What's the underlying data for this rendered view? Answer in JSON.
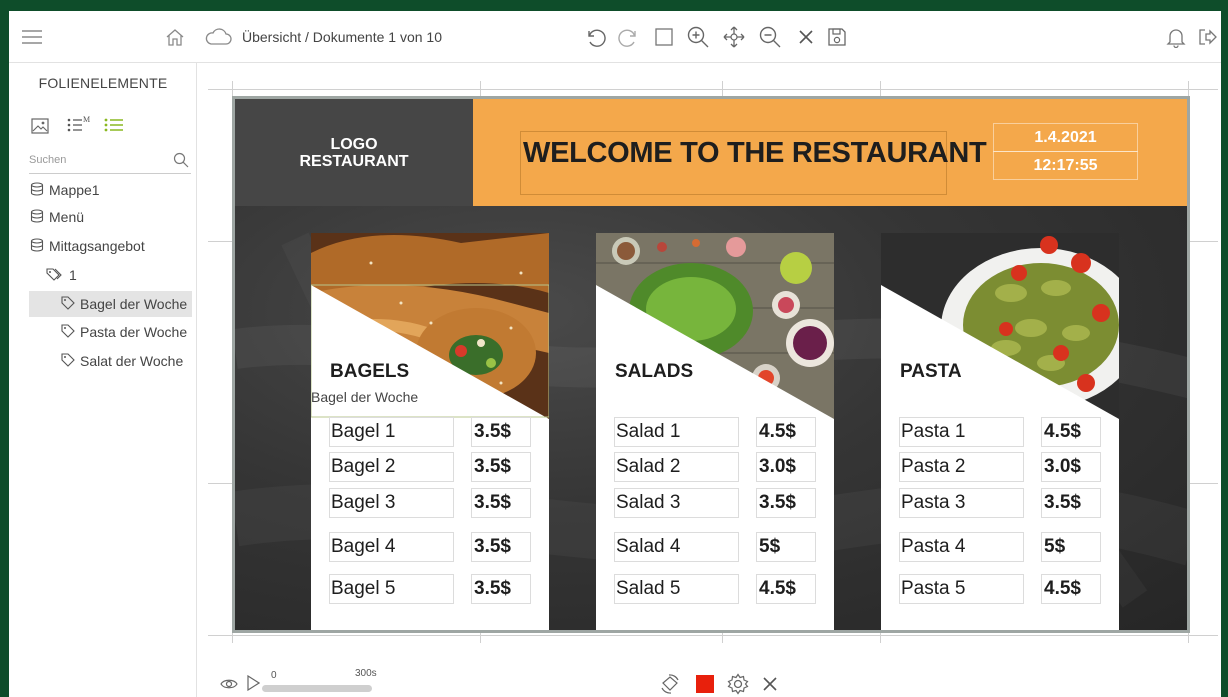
{
  "toolbar": {
    "breadcrumb": "Übersicht / Dokumente  1 von 10",
    "icons": [
      "menu-icon",
      "home-icon",
      "cloud-icon",
      "undo-icon",
      "redo-icon",
      "square-select-icon",
      "zoom-in-icon",
      "move-icon",
      "zoom-out-icon",
      "close-icon",
      "save-icon",
      "bell-icon",
      "logout-icon"
    ]
  },
  "sidebar": {
    "title": "FOLIENELEMENTE",
    "search_placeholder": "Suchen",
    "tree": [
      {
        "label": "Mappe1",
        "type": "database"
      },
      {
        "label": "Menü",
        "type": "database"
      },
      {
        "label": "Mittagsangebot",
        "type": "database"
      },
      {
        "label": "1",
        "type": "tags"
      },
      {
        "label": "Bagel der Woche",
        "type": "tag",
        "selected": true
      },
      {
        "label": "Pasta der Woche",
        "type": "tag"
      },
      {
        "label": "Salat der Woche",
        "type": "tag"
      }
    ]
  },
  "slide": {
    "logo_line1": "LOGO",
    "logo_line2": "RESTAURANT",
    "banner_title": "WELCOME TO THE RESTAURANT",
    "date": "1.4.2021",
    "time": "12:17:55",
    "colors": {
      "banner": "#f4a84b",
      "logo_bg": "#464646",
      "board": "#353535"
    },
    "cards": [
      {
        "heading": "BAGELS",
        "subtitle": "Bagel der Woche",
        "items": [
          {
            "name": "Bagel 1",
            "price": "3.5$"
          },
          {
            "name": "Bagel 2",
            "price": "3.5$"
          },
          {
            "name": "Bagel 3",
            "price": "3.5$"
          },
          {
            "name": "Bagel 4",
            "price": "3.5$"
          },
          {
            "name": "Bagel 5",
            "price": "3.5$"
          }
        ]
      },
      {
        "heading": "SALADS",
        "items": [
          {
            "name": "Salad 1",
            "price": "4.5$"
          },
          {
            "name": "Salad 2",
            "price": "3.0$"
          },
          {
            "name": "Salad 3",
            "price": "3.5$"
          },
          {
            "name": "Salad 4",
            "price": "5$"
          },
          {
            "name": "Salad 5",
            "price": "4.5$"
          }
        ]
      },
      {
        "heading": "PASTA",
        "items": [
          {
            "name": "Pasta 1",
            "price": "4.5$"
          },
          {
            "name": "Pasta 2",
            "price": "3.0$"
          },
          {
            "name": "Pasta 3",
            "price": "3.5$"
          },
          {
            "name": "Pasta 4",
            "price": "5$"
          },
          {
            "name": "Pasta 5",
            "price": "4.5$"
          }
        ]
      }
    ]
  },
  "playback": {
    "start_label": "0",
    "end_label": "300s",
    "stop_color": "#e8200c"
  }
}
